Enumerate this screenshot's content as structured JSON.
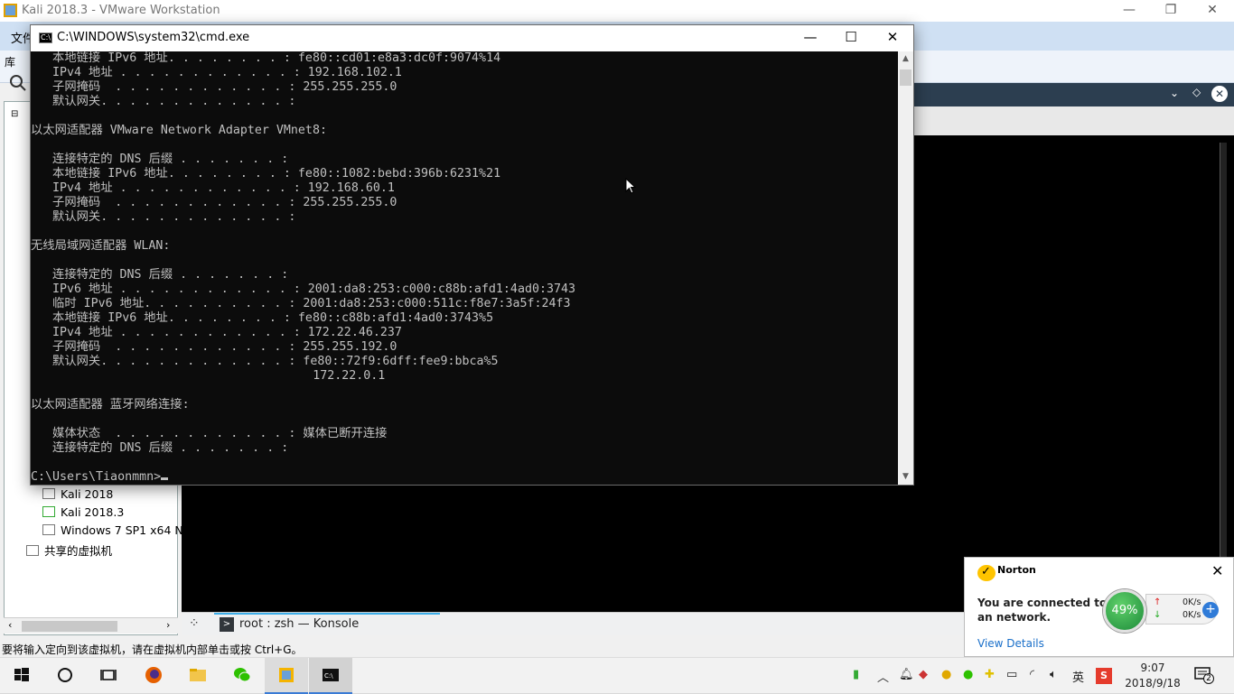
{
  "vmware": {
    "title": "Kali 2018.3 - VMware Workstation",
    "menu_file": "文件",
    "library_label": "库",
    "library": {
      "items": [
        {
          "label": "Kali 2018"
        },
        {
          "label": "Kali 2018.3"
        },
        {
          "label": "Windows 7 SP1 x64 N"
        }
      ],
      "shared": "共享的虚拟机"
    },
    "konsole_tab": "root : zsh — Konsole",
    "status_text": "要将输入定向到该虚拟机，请在虚拟机内部单击或按 Ctrl+G。"
  },
  "cmd": {
    "title": "C:\\WINDOWS\\system32\\cmd.exe",
    "lines": [
      "   本地链接 IPv6 地址. . . . . . . . : fe80::cd01:e8a3:dc0f:9074%14",
      "   IPv4 地址 . . . . . . . . . . . . : 192.168.102.1",
      "   子网掩码  . . . . . . . . . . . . : 255.255.255.0",
      "   默认网关. . . . . . . . . . . . . :",
      "",
      "以太网适配器 VMware Network Adapter VMnet8:",
      "",
      "   连接特定的 DNS 后缀 . . . . . . . :",
      "   本地链接 IPv6 地址. . . . . . . . : fe80::1082:bebd:396b:6231%21",
      "   IPv4 地址 . . . . . . . . . . . . : 192.168.60.1",
      "   子网掩码  . . . . . . . . . . . . : 255.255.255.0",
      "   默认网关. . . . . . . . . . . . . :",
      "",
      "无线局域网适配器 WLAN:",
      "",
      "   连接特定的 DNS 后缀 . . . . . . . :",
      "   IPv6 地址 . . . . . . . . . . . . : 2001:da8:253:c000:c88b:afd1:4ad0:3743",
      "   临时 IPv6 地址. . . . . . . . . . : 2001:da8:253:c000:511c:f8e7:3a5f:24f3",
      "   本地链接 IPv6 地址. . . . . . . . : fe80::c88b:afd1:4ad0:3743%5",
      "   IPv4 地址 . . . . . . . . . . . . : 172.22.46.237",
      "   子网掩码  . . . . . . . . . . . . : 255.255.192.0",
      "   默认网关. . . . . . . . . . . . . : fe80::72f9:6dff:fee9:bbca%5",
      "                                       172.22.0.1",
      "",
      "以太网适配器 蓝牙网络连接:",
      "",
      "   媒体状态  . . . . . . . . . . . . : 媒体已断开连接",
      "   连接特定的 DNS 后缀 . . . . . . . :",
      ""
    ],
    "prompt": "C:\\Users\\Tiaonmmn>"
  },
  "norton": {
    "brand": "Norton",
    "message": "You are connected to an network.",
    "percent": "49%",
    "upload": "0K/s",
    "download": "0K/s",
    "link": "View Details"
  },
  "taskbar": {
    "ime": "英",
    "time": "9:07",
    "date": "2018/9/18",
    "notifications": "2"
  }
}
